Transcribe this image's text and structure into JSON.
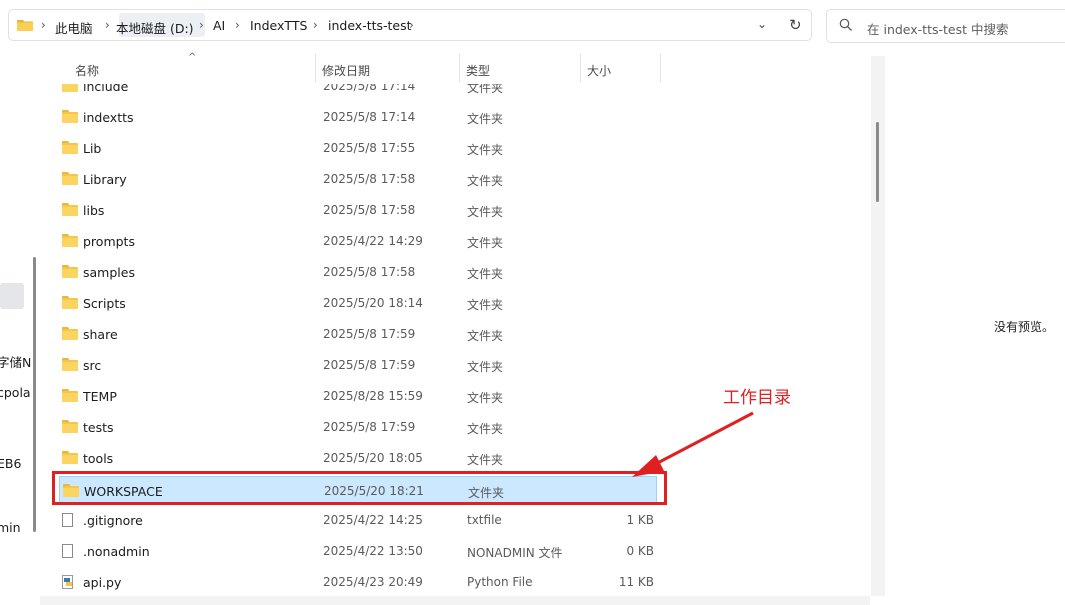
{
  "address_bar": {
    "crumbs": [
      "此电脑",
      "本地磁盘 (D:)",
      "AI",
      "IndexTTS",
      "index-tts-test"
    ]
  },
  "search": {
    "placeholder": "在 index-tts-test 中搜索"
  },
  "columns": {
    "name": "名称",
    "date": "修改日期",
    "type": "类型",
    "size": "大小"
  },
  "files": [
    {
      "name": "include",
      "date": "2025/5/8 17:14",
      "type": "文件夹",
      "size": "",
      "icon": "folder-icon"
    },
    {
      "name": "indextts",
      "date": "2025/5/8 17:14",
      "type": "文件夹",
      "size": "",
      "icon": "folder-icon"
    },
    {
      "name": "Lib",
      "date": "2025/5/8 17:55",
      "type": "文件夹",
      "size": "",
      "icon": "folder-icon"
    },
    {
      "name": "Library",
      "date": "2025/5/8 17:58",
      "type": "文件夹",
      "size": "",
      "icon": "folder-icon"
    },
    {
      "name": "libs",
      "date": "2025/5/8 17:58",
      "type": "文件夹",
      "size": "",
      "icon": "folder-icon"
    },
    {
      "name": "prompts",
      "date": "2025/4/22 14:29",
      "type": "文件夹",
      "size": "",
      "icon": "folder-icon"
    },
    {
      "name": "samples",
      "date": "2025/5/8 17:58",
      "type": "文件夹",
      "size": "",
      "icon": "folder-icon"
    },
    {
      "name": "Scripts",
      "date": "2025/5/20 18:14",
      "type": "文件夹",
      "size": "",
      "icon": "folder-icon"
    },
    {
      "name": "share",
      "date": "2025/5/8 17:59",
      "type": "文件夹",
      "size": "",
      "icon": "folder-icon"
    },
    {
      "name": "src",
      "date": "2025/5/8 17:59",
      "type": "文件夹",
      "size": "",
      "icon": "folder-icon"
    },
    {
      "name": "TEMP",
      "date": "2025/8/28 15:59",
      "type": "文件夹",
      "size": "",
      "icon": "folder-icon"
    },
    {
      "name": "tests",
      "date": "2025/5/8 17:59",
      "type": "文件夹",
      "size": "",
      "icon": "folder-icon"
    },
    {
      "name": "tools",
      "date": "2025/5/20 18:05",
      "type": "文件夹",
      "size": "",
      "icon": "folder-icon"
    },
    {
      "name": "WORKSPACE",
      "date": "2025/5/20 18:21",
      "type": "文件夹",
      "size": "",
      "icon": "folder-icon",
      "selected": true
    },
    {
      "name": ".gitignore",
      "date": "2025/4/22 14:25",
      "type": "txtfile",
      "size": "1 KB",
      "icon": "file-icon"
    },
    {
      "name": ".nonadmin",
      "date": "2025/4/22 13:50",
      "type": "NONADMIN 文件",
      "size": "0 KB",
      "icon": "file-icon"
    },
    {
      "name": "api.py",
      "date": "2025/4/23 20:49",
      "type": "Python File",
      "size": "11 KB",
      "icon": "python-file-icon"
    }
  ],
  "left_pane_fragments": [
    "字储N",
    "cpola",
    "EB6",
    "min"
  ],
  "preview": {
    "message": "没有预览。"
  },
  "annotation": {
    "text": "工作目录",
    "color": "#e02020"
  },
  "colors": {
    "selection": "#cce8ff",
    "folder": "#f6c746",
    "annotation": "#e02020"
  }
}
